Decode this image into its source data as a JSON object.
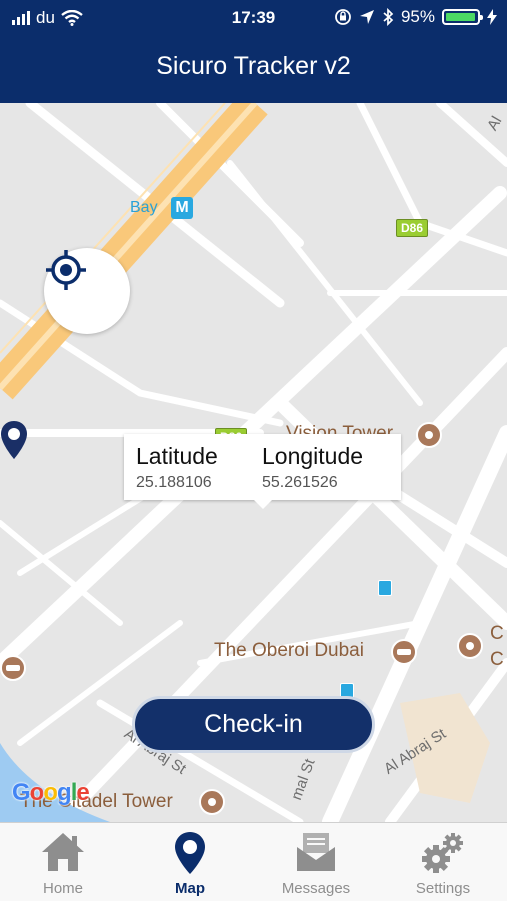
{
  "status_bar": {
    "carrier": "du",
    "time": "17:39",
    "battery": "95%",
    "battery_level": 0.95
  },
  "header": {
    "title": "Sicuro Tracker v2"
  },
  "map": {
    "callout": {
      "latitude_label": "Latitude",
      "latitude_value": "25.188106",
      "longitude_label": "Longitude",
      "longitude_value": "55.261526"
    },
    "labels": {
      "vision_tower": "Vision Tower",
      "oberoi": "The Oberoi Dubai",
      "citadel": "The Citadel Tower",
      "bay": "Bay",
      "metro": "M",
      "road_d86": "D86",
      "street_al_abraj": "Al Abraj St",
      "street_left": "Al Abraj St",
      "street_mid": "mal St",
      "edge_c1": "C",
      "edge_c2": "C",
      "edge_al": "Al"
    },
    "google": [
      "G",
      "o",
      "o",
      "g",
      "l",
      "e"
    ]
  },
  "checkin_label": "Check-in",
  "tabs": [
    {
      "label": "Home",
      "icon": "home-icon"
    },
    {
      "label": "Map",
      "icon": "map-pin-icon",
      "active": true
    },
    {
      "label": "Messages",
      "icon": "envelope-icon"
    },
    {
      "label": "Settings",
      "icon": "gears-icon"
    }
  ],
  "colors": {
    "brand": "#0b2d6b",
    "button": "#13306a",
    "battery": "#4cd964",
    "poi": "#a9785a"
  }
}
